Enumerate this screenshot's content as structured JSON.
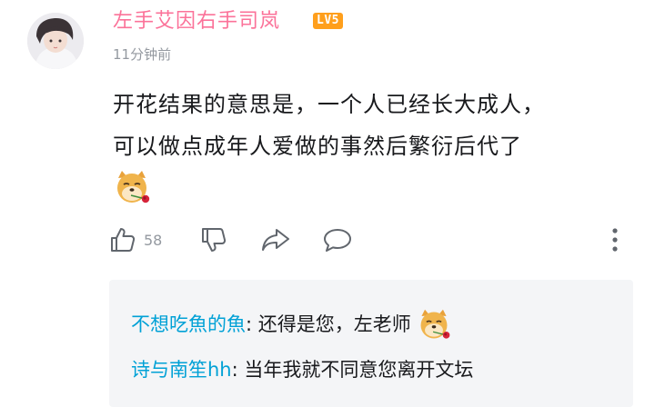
{
  "comment": {
    "username": "左手艾因右手司岚",
    "level": "LV5",
    "time": "11分钟前",
    "content_lines": [
      "开花结果的意思是，一个人已经长大成人，",
      "可以做点成年人爱做的事然后繁衍后代了"
    ],
    "sticker": "doge-rose-icon",
    "like_count": "58",
    "colors": {
      "username": "#fb7299",
      "level_badge": "#ff9f1c",
      "reply_name": "#00a1d6",
      "muted": "#9499a0"
    }
  },
  "replies": [
    {
      "name": "不想吃魚的魚",
      "sep": ": ",
      "text": "还得是您，左老师",
      "sticker": "doge-rose-icon"
    },
    {
      "name": "诗与南笙hh",
      "sep": ": ",
      "text": "当年我就不同意您离开文坛"
    }
  ]
}
